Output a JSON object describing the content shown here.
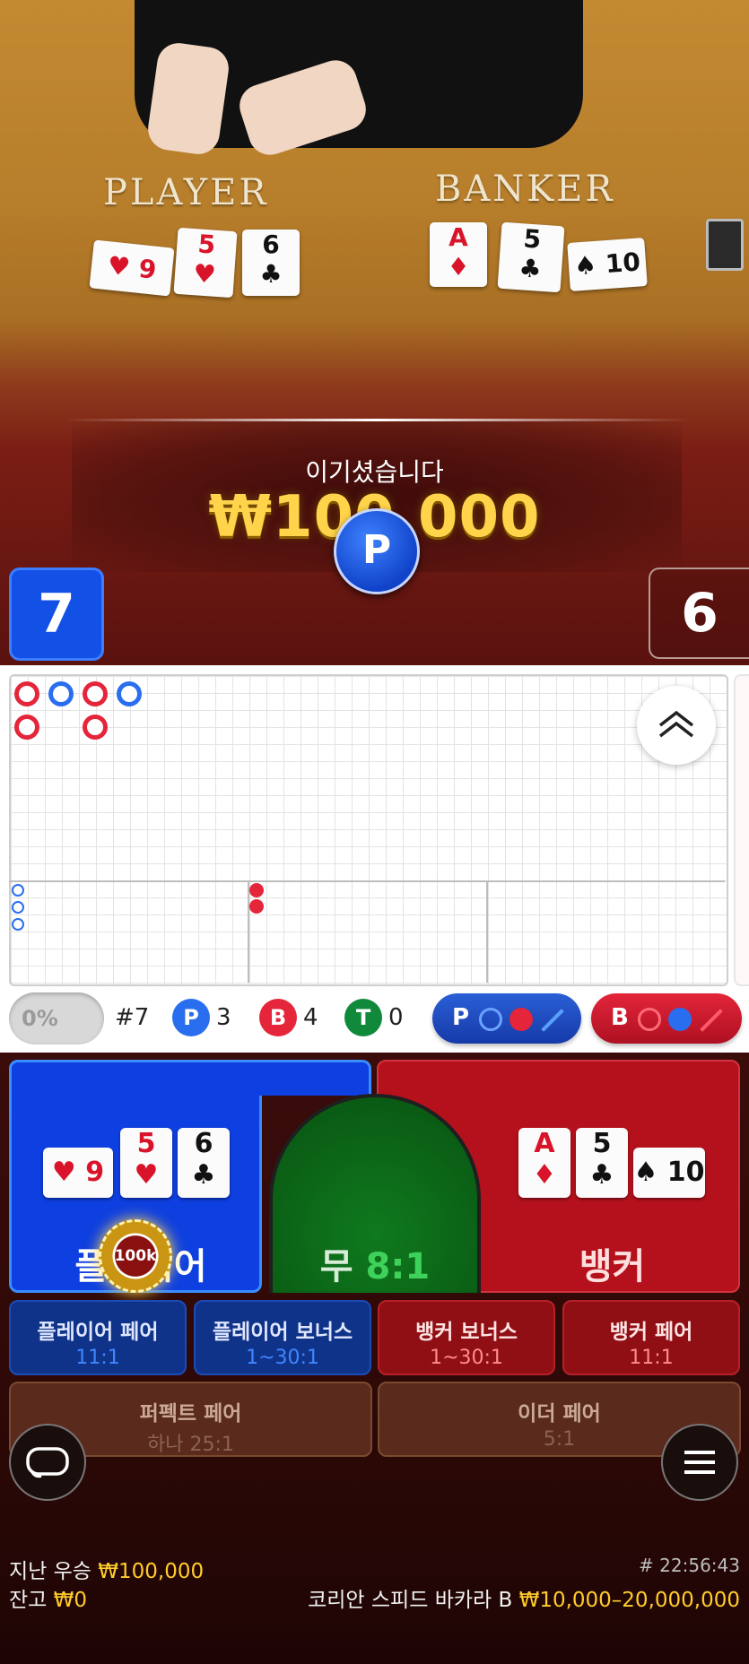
{
  "table": {
    "player_label": "PLAYER",
    "banker_label": "BANKER",
    "player_cards": [
      {
        "rank": "9",
        "suit": "♥",
        "color": "red"
      },
      {
        "rank": "5",
        "suit": "♥",
        "color": "red"
      },
      {
        "rank": "6",
        "suit": "♣",
        "color": "black"
      }
    ],
    "banker_cards": [
      {
        "rank": "A",
        "suit": "♦",
        "color": "red"
      },
      {
        "rank": "5",
        "suit": "♣",
        "color": "black"
      },
      {
        "rank": "10",
        "suit": "♠",
        "color": "black"
      }
    ]
  },
  "result": {
    "message": "이기셨습니다",
    "amount": "₩100,000",
    "winner_badge": "P",
    "player_score": "7",
    "banker_score": "6"
  },
  "roadmap": {
    "bead_road": [
      [
        "B",
        "B"
      ],
      [
        "P"
      ],
      [
        "B",
        "B"
      ],
      [
        "P"
      ]
    ],
    "small_p_count": 3,
    "small_b_count": 2
  },
  "stats": {
    "percent": "0%",
    "round": "#7",
    "player_badge": "P",
    "player_count": "3",
    "banker_badge": "B",
    "banker_count": "4",
    "tie_badge": "T",
    "tie_count": "0",
    "predict_player_letter": "P",
    "predict_banker_letter": "B"
  },
  "bets": {
    "player_label": "플레이어",
    "tie_label": "무",
    "tie_odds": "8:1",
    "banker_label": "뱅커",
    "chip_value": "100k",
    "side_bets": [
      {
        "name": "플레이어 페어",
        "odds": "11:1"
      },
      {
        "name": "플레이어 보너스",
        "odds": "1~30:1"
      },
      {
        "name": "뱅커 보너스",
        "odds": "1~30:1"
      },
      {
        "name": "뱅커 페어",
        "odds": "11:1"
      }
    ],
    "perfect_pair": {
      "name": "퍼펙트 페어",
      "odds": "하나 25:1"
    },
    "either_pair": {
      "name": "이더 페어",
      "odds": "5:1"
    }
  },
  "footer": {
    "last_win_label": "지난 우승",
    "last_win_value": "₩100,000",
    "balance_label": "잔고",
    "balance_value": "₩0",
    "round_time": "# 22:56:43",
    "game_name": "코리안 스피드 바카라 B",
    "limits": "₩10,000–20,000,000"
  },
  "colors": {
    "player_blue": "#0e3fe0",
    "banker_red": "#b5111c",
    "tie_green": "#0f7a1e",
    "gold": "#ffcc2a"
  }
}
